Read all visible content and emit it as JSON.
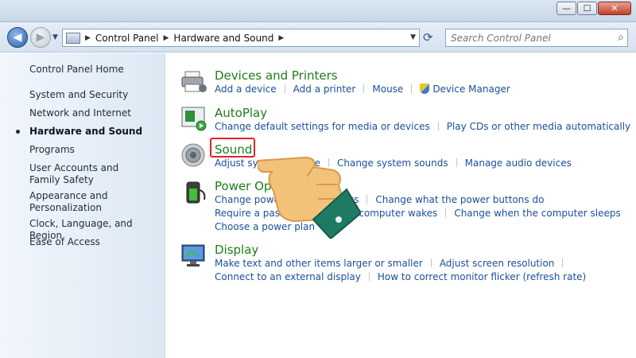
{
  "window": {
    "minimize_glyph": "—",
    "maximize_glyph": "☐",
    "close_glyph": "✕"
  },
  "nav": {
    "back_glyph": "◀",
    "forward_glyph": "▶",
    "breadcrumb": [
      "Control Panel",
      "Hardware and Sound"
    ],
    "refresh_icon": "refresh-icon",
    "search_placeholder": "Search Control Panel"
  },
  "sidebar": {
    "items": [
      {
        "label": "Control Panel Home"
      },
      {
        "label": "System and Security"
      },
      {
        "label": "Network and Internet"
      },
      {
        "label": "Hardware and Sound",
        "active": true
      },
      {
        "label": "Programs"
      },
      {
        "label": "User Accounts and Family Safety"
      },
      {
        "label": "Appearance and Personalization"
      },
      {
        "label": "Clock, Language, and Region"
      },
      {
        "label": "Ease of Access"
      }
    ]
  },
  "categories": {
    "devices": {
      "title": "Devices and Printers",
      "icon": "printer-icon",
      "links": [
        "Add a device",
        "Add a printer",
        "Mouse",
        "Device Manager"
      ]
    },
    "autoplay": {
      "title": "AutoPlay",
      "icon": "autoplay-icon",
      "links": [
        "Change default settings for media or devices",
        "Play CDs or other media automatically"
      ]
    },
    "sound": {
      "title": "Sound",
      "icon": "speaker-icon",
      "links": [
        "Adjust system volume",
        "Change system sounds",
        "Manage audio devices"
      ]
    },
    "power": {
      "title": "Power Options",
      "icon": "battery-icon",
      "links_row1": [
        "Change power-saving settings",
        "Change what the power buttons do"
      ],
      "links_row2": [
        "Require a password when the computer wakes",
        "Change when the computer sleeps"
      ],
      "links_row3": [
        "Choose a power plan"
      ]
    },
    "display": {
      "title": "Display",
      "icon": "monitor-icon",
      "links_row1": [
        "Make text and other items larger or smaller",
        "Adjust screen resolution"
      ],
      "links_row2": [
        "Connect to an external display",
        "How to correct monitor flicker (refresh rate)"
      ]
    }
  },
  "colors": {
    "link": "#1a4f9a",
    "category_title": "#1e7d1a",
    "highlight": "#e2222a",
    "hand_skin": "#f2c27a",
    "hand_cuff": "#1f7a64"
  }
}
